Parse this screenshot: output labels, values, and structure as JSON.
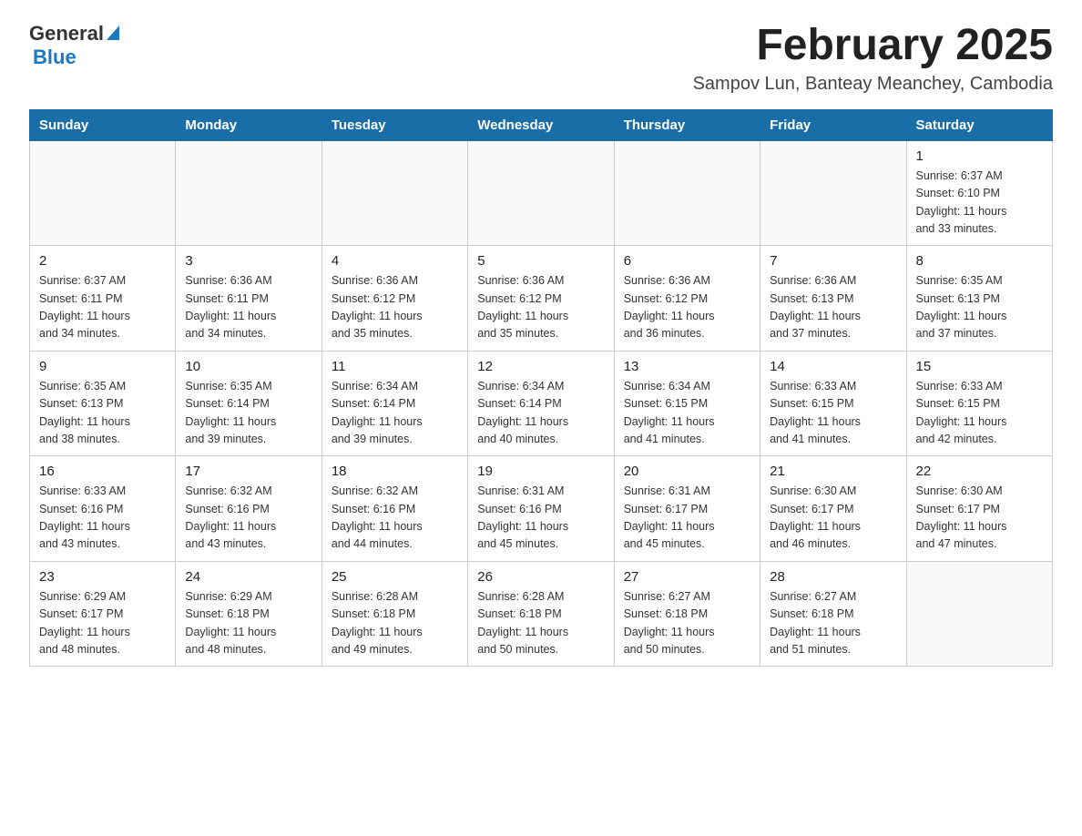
{
  "header": {
    "logo": {
      "general": "General",
      "blue": "Blue"
    },
    "title": "February 2025",
    "subtitle": "Sampov Lun, Banteay Meanchey, Cambodia"
  },
  "calendar": {
    "days_of_week": [
      "Sunday",
      "Monday",
      "Tuesday",
      "Wednesday",
      "Thursday",
      "Friday",
      "Saturday"
    ],
    "weeks": [
      [
        {
          "day": "",
          "info": ""
        },
        {
          "day": "",
          "info": ""
        },
        {
          "day": "",
          "info": ""
        },
        {
          "day": "",
          "info": ""
        },
        {
          "day": "",
          "info": ""
        },
        {
          "day": "",
          "info": ""
        },
        {
          "day": "1",
          "info": "Sunrise: 6:37 AM\nSunset: 6:10 PM\nDaylight: 11 hours\nand 33 minutes."
        }
      ],
      [
        {
          "day": "2",
          "info": "Sunrise: 6:37 AM\nSunset: 6:11 PM\nDaylight: 11 hours\nand 34 minutes."
        },
        {
          "day": "3",
          "info": "Sunrise: 6:36 AM\nSunset: 6:11 PM\nDaylight: 11 hours\nand 34 minutes."
        },
        {
          "day": "4",
          "info": "Sunrise: 6:36 AM\nSunset: 6:12 PM\nDaylight: 11 hours\nand 35 minutes."
        },
        {
          "day": "5",
          "info": "Sunrise: 6:36 AM\nSunset: 6:12 PM\nDaylight: 11 hours\nand 35 minutes."
        },
        {
          "day": "6",
          "info": "Sunrise: 6:36 AM\nSunset: 6:12 PM\nDaylight: 11 hours\nand 36 minutes."
        },
        {
          "day": "7",
          "info": "Sunrise: 6:36 AM\nSunset: 6:13 PM\nDaylight: 11 hours\nand 37 minutes."
        },
        {
          "day": "8",
          "info": "Sunrise: 6:35 AM\nSunset: 6:13 PM\nDaylight: 11 hours\nand 37 minutes."
        }
      ],
      [
        {
          "day": "9",
          "info": "Sunrise: 6:35 AM\nSunset: 6:13 PM\nDaylight: 11 hours\nand 38 minutes."
        },
        {
          "day": "10",
          "info": "Sunrise: 6:35 AM\nSunset: 6:14 PM\nDaylight: 11 hours\nand 39 minutes."
        },
        {
          "day": "11",
          "info": "Sunrise: 6:34 AM\nSunset: 6:14 PM\nDaylight: 11 hours\nand 39 minutes."
        },
        {
          "day": "12",
          "info": "Sunrise: 6:34 AM\nSunset: 6:14 PM\nDaylight: 11 hours\nand 40 minutes."
        },
        {
          "day": "13",
          "info": "Sunrise: 6:34 AM\nSunset: 6:15 PM\nDaylight: 11 hours\nand 41 minutes."
        },
        {
          "day": "14",
          "info": "Sunrise: 6:33 AM\nSunset: 6:15 PM\nDaylight: 11 hours\nand 41 minutes."
        },
        {
          "day": "15",
          "info": "Sunrise: 6:33 AM\nSunset: 6:15 PM\nDaylight: 11 hours\nand 42 minutes."
        }
      ],
      [
        {
          "day": "16",
          "info": "Sunrise: 6:33 AM\nSunset: 6:16 PM\nDaylight: 11 hours\nand 43 minutes."
        },
        {
          "day": "17",
          "info": "Sunrise: 6:32 AM\nSunset: 6:16 PM\nDaylight: 11 hours\nand 43 minutes."
        },
        {
          "day": "18",
          "info": "Sunrise: 6:32 AM\nSunset: 6:16 PM\nDaylight: 11 hours\nand 44 minutes."
        },
        {
          "day": "19",
          "info": "Sunrise: 6:31 AM\nSunset: 6:16 PM\nDaylight: 11 hours\nand 45 minutes."
        },
        {
          "day": "20",
          "info": "Sunrise: 6:31 AM\nSunset: 6:17 PM\nDaylight: 11 hours\nand 45 minutes."
        },
        {
          "day": "21",
          "info": "Sunrise: 6:30 AM\nSunset: 6:17 PM\nDaylight: 11 hours\nand 46 minutes."
        },
        {
          "day": "22",
          "info": "Sunrise: 6:30 AM\nSunset: 6:17 PM\nDaylight: 11 hours\nand 47 minutes."
        }
      ],
      [
        {
          "day": "23",
          "info": "Sunrise: 6:29 AM\nSunset: 6:17 PM\nDaylight: 11 hours\nand 48 minutes."
        },
        {
          "day": "24",
          "info": "Sunrise: 6:29 AM\nSunset: 6:18 PM\nDaylight: 11 hours\nand 48 minutes."
        },
        {
          "day": "25",
          "info": "Sunrise: 6:28 AM\nSunset: 6:18 PM\nDaylight: 11 hours\nand 49 minutes."
        },
        {
          "day": "26",
          "info": "Sunrise: 6:28 AM\nSunset: 6:18 PM\nDaylight: 11 hours\nand 50 minutes."
        },
        {
          "day": "27",
          "info": "Sunrise: 6:27 AM\nSunset: 6:18 PM\nDaylight: 11 hours\nand 50 minutes."
        },
        {
          "day": "28",
          "info": "Sunrise: 6:27 AM\nSunset: 6:18 PM\nDaylight: 11 hours\nand 51 minutes."
        },
        {
          "day": "",
          "info": ""
        }
      ]
    ]
  }
}
